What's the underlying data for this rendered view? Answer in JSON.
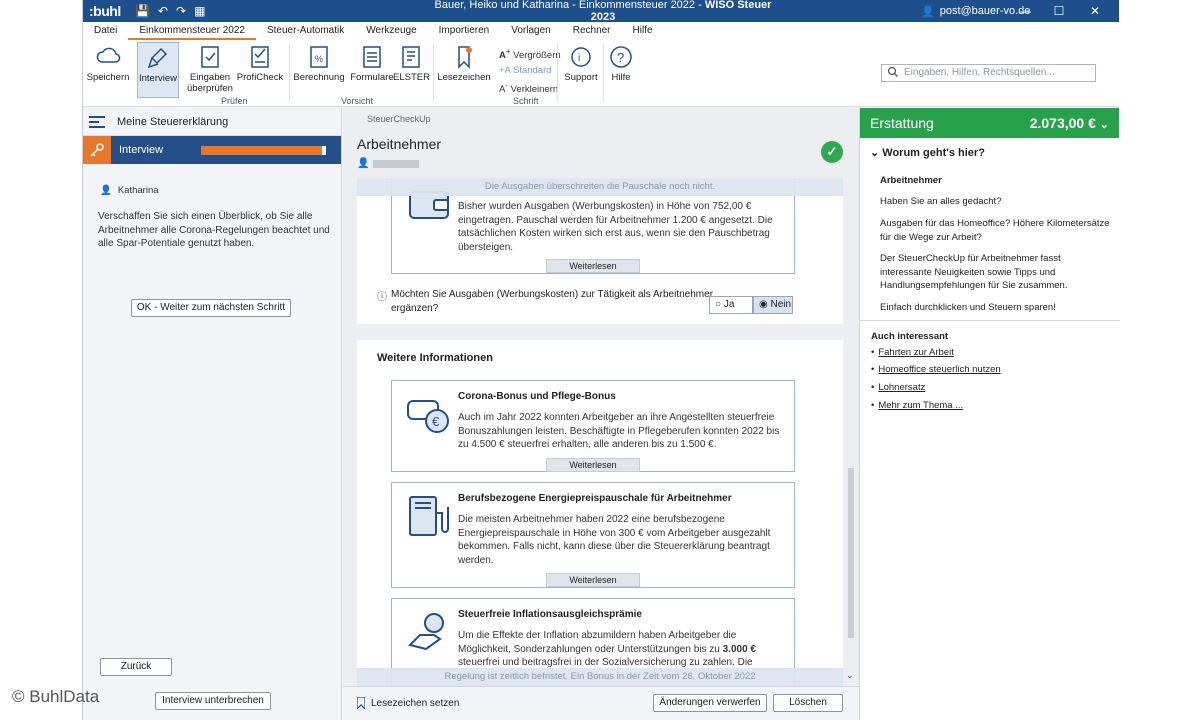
{
  "titlebar": {
    "logo": ":buhl",
    "title_prefix": "Bauer, Heiko und Katharina - Einkommensteuer 2022 - ",
    "title_app": "WISO Steuer 2023",
    "user": "post@bauer-vo.de"
  },
  "menu": [
    "Datei",
    "Einkommensteuer 2022",
    "Steuer-Automatik",
    "Werkzeuge",
    "Importieren",
    "Vorlagen",
    "Rechner",
    "Hilfe"
  ],
  "ribbon": {
    "speichern": "Speichern",
    "interview": "Interview",
    "eingaben_1": "Eingaben",
    "eingaben_2": "überprüfen",
    "proficheck": "ProfiCheck",
    "group_pruefen": "Prüfen",
    "berechnung": "Berechnung",
    "formulare": "Formulare",
    "elster": "ELSTER",
    "group_vorsicht": "Vorsicht",
    "lesezeichen": "Lesezeichen",
    "vergroessern": "Vergrößern",
    "standard": "Standard",
    "verkleinern": "Verkleinern",
    "group_schrift": "Schrift",
    "support": "Support",
    "hilfe": "Hilfe",
    "search_placeholder": "Eingaben, Hilfen, Rechtsquellen..."
  },
  "left": {
    "header": "Meine Steuererklärung",
    "interview_label": "Interview",
    "progress": 0.97,
    "person": "Katharina",
    "text": "Verschaffen Sie sich einen Überblick, ob Sie alle Arbeitnehmer alle Corona-Regelungen beachtet und alle Spar-Potentiale genutzt haben.",
    "ok_button": "OK - Weiter zum nächsten Schritt",
    "back_button": "Zurück",
    "pause_button": "Interview unterbrechen"
  },
  "center": {
    "breadcrumb": "SteuerCheckUp",
    "title": "Arbeitnehmer",
    "top_fade": "Die Ausgaben überschreiten die Pauschale noch nicht.",
    "card0_text": "Bisher wurden Ausgaben (Werbungskosten) in Höhe von 752,00 € eingetragen. Pauschal werden für Arbeitnehmer 1.200 € angesetzt. Die tatsächlichen Kosten wirken sich erst aus, wenn sie den Pauschbetrag übersteigen.",
    "weiterlesen": "Weiterlesen",
    "question": "Möchten Sie Ausgaben (Werbungskosten) zur Tätigkeit als Arbeitnehmer ergänzen?",
    "ja": "Ja",
    "nein": "Nein",
    "section_title": "Weitere Informationen",
    "card1_title": "Corona-Bonus und Pflege-Bonus",
    "card1_text": "Auch im Jahr 2022 konnten Arbeitgeber an ihre Angestellten steuerfreie Bonuszahlungen leisten. Beschäftigte in Pflegeberufen konnten 2022 bis zu 4.500 € steuerfrei erhalten, alle anderen bis zu 1.500 €.",
    "card2_title": "Berufsbezogene Energiepreispauschale für Arbeitnehmer",
    "card2_text": "Die meisten Arbeitnehmer haben 2022 eine berufsbezogene Energiepreispauschale in Höhe von 300 € vom Arbeitgeber ausgezahlt bekommen. Falls nicht, kann diese über die Steuererklärung beantragt werden.",
    "card3_title": "Steuerfreie Inflationsausgleichsprämie",
    "card3_text_a": "Um die Effekte der Inflation abzumildern haben Arbeitgeber die Möglichkeit, Sonderzahlungen oder Unterstützungen bis zu ",
    "card3_text_bold": "3.000 €",
    "card3_text_b": " steuerfrei und beitragsfrei in der Sozialversicherung zu zahlen. Die",
    "bottom_fade": "Regelung ist zeitlich befristet. Ein Bonus in der Zeit vom 26. Oktober 2022",
    "bookmark": "Lesezeichen setzen",
    "discard_button": "Änderungen verwerfen",
    "delete_button": "Löschen"
  },
  "right": {
    "label": "Erstattung",
    "amount": "2.073,00 €",
    "heading": "Worum geht's hier?",
    "subheading": "Arbeitnehmer",
    "p1": "Haben Sie an alles gedacht?",
    "p2": "Ausgaben für das Homeoffice? Höhere Kilometersätze für die Wege zur Arbeit?",
    "p3": "Der SteuerCheckUp für Arbeitnehmer fasst interessante Neuigkeiten sowie Tipps und Handlungsempfehlungen für Sie zusammen.",
    "p4": "Einfach durchklicken und Steuern sparen!",
    "also": "Auch interessant",
    "links": [
      "Fahrten zur Arbeit",
      "Homeoffice steuerlich nutzen",
      "Lohnersatz",
      "Mehr zum Thema ..."
    ]
  },
  "watermark": "© BuhlData",
  "colors": {
    "brand_blue": "#1c4f8b",
    "accent_orange": "#e8772b",
    "success_green": "#27a24a"
  }
}
